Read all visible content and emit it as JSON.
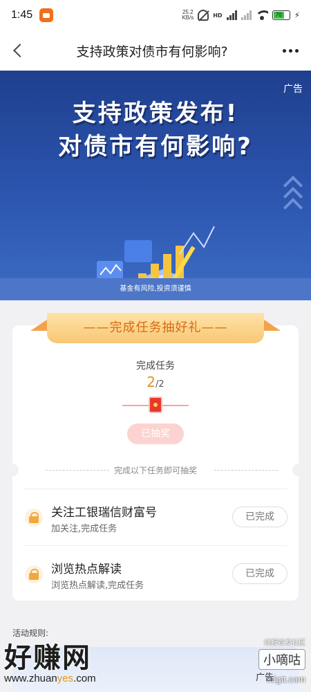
{
  "status_bar": {
    "time": "1:45",
    "speed_value": "25.2",
    "speed_unit": "KB/s",
    "hd": "HD",
    "battery": "70"
  },
  "nav": {
    "title": "支持政策对债市有何影响?"
  },
  "banner": {
    "ad_label": "广告",
    "headline_line1": "支持政策发布!",
    "headline_line2": "对债市有何影响?",
    "disclaimer": "基金有风险,投资须谨慎"
  },
  "task_card": {
    "ribbon_title": "——完成任务抽好礼——",
    "title": "完成任务",
    "progress_done": "2",
    "progress_total": "/2",
    "draw_button": "已抽奖",
    "divider_text": "完成以下任务即可抽奖",
    "tasks": [
      {
        "name": "关注工银瑞信财富号",
        "desc": "加关注,完成任务",
        "status": "已完成"
      },
      {
        "name": "浏览热点解读",
        "desc": "浏览热点解读,完成任务",
        "status": "已完成"
      }
    ]
  },
  "rules": {
    "label": "活动规则:"
  },
  "watermarks": {
    "left_big": "好赚网",
    "left_url_prefix": "www.zhuan",
    "left_url_highlight": "yes",
    "left_url_suffix": ".com",
    "right_sub": "线报首发社区",
    "right_brand": "小嘀咕",
    "right_site": "xdgtt.com",
    "bottom_ad": "广告"
  },
  "colors": {
    "accent_orange": "#e6911f",
    "banner_blue": "#2c56b0",
    "draw_button_pink": "#fcd3d0"
  }
}
